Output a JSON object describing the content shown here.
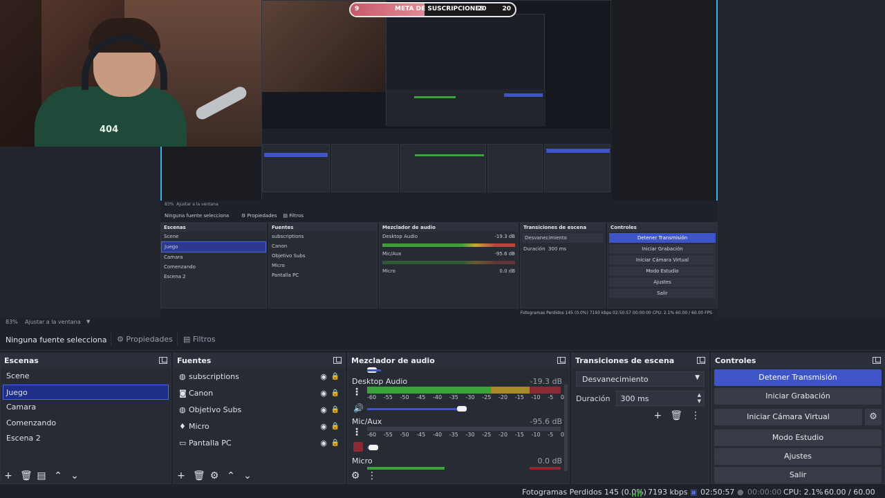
{
  "overlay": {
    "goal_label": "META DE SUSCRIPCIONES",
    "goal_current": "9",
    "goal_mid": "20",
    "goal_target": "20"
  },
  "webcam": {
    "shirt_text": "404"
  },
  "mirror": {
    "zoom": "83%",
    "fit_label": "Ajustar a la ventana",
    "no_source": "Ninguna fuente selecciona",
    "props_tab": "Propiedades",
    "filters_tab": "Filtros",
    "scenes_title": "Escenas",
    "scenes": [
      "Scene",
      "Juego",
      "Camara",
      "Comenzando",
      "Escena 2"
    ],
    "sources_title": "Fuentes",
    "sources": [
      "subscriptions",
      "Canon",
      "Objetivo Subs",
      "Micro",
      "Pantalla PC"
    ],
    "mixer_title": "Mezclador de audio",
    "ch1": "Desktop Audio",
    "ch1_db": "-19.3 dB",
    "ch2": "Mic/Aux",
    "ch2_db": "-95.6 dB",
    "ch3": "Micro",
    "ch3_db": "0.0 dB",
    "trans_title": "Transiciones de escena",
    "trans_value": "Desvanecimiento",
    "duration_label": "Duración",
    "duration_value": "300 ms",
    "controls_title": "Controles",
    "controls": [
      "Detener Transmisión",
      "Iniciar Grabación",
      "Iniciar Cámara Virtual",
      "Modo Estudio",
      "Ajustes",
      "Salir"
    ],
    "status": "Fotogramas Perdidos 145 (0.0%)   7193 kbps   02:50:57   00:00:00   CPU: 2.1%   60.00 / 60.00 FPS"
  },
  "zoom_bar": {
    "zoom": "83%",
    "fit_label": "Ajustar a la ventana"
  },
  "props_bar": {
    "no_source": "Ninguna fuente selecciona",
    "props_tab": "Propiedades",
    "filters_tab": "Filtros"
  },
  "scenes": {
    "title": "Escenas",
    "items": [
      "Scene",
      "Juego",
      "Camara",
      "Comenzando",
      "Escena 2"
    ],
    "selected_index": 1
  },
  "sources": {
    "title": "Fuentes",
    "items": [
      {
        "label": "subscriptions",
        "icon": "globe-icon"
      },
      {
        "label": "Canon",
        "icon": "camera-icon"
      },
      {
        "label": "Objetivo Subs",
        "icon": "globe-icon"
      },
      {
        "label": "Micro",
        "icon": "microphone-icon"
      },
      {
        "label": "Pantalla PC",
        "icon": "monitor-icon"
      }
    ]
  },
  "mixer": {
    "title": "Mezclador de audio",
    "ticks": [
      "-60",
      "-55",
      "-50",
      "-45",
      "-40",
      "-35",
      "-30",
      "-25",
      "-20",
      "-15",
      "-10",
      "-5",
      "0"
    ],
    "channels": [
      {
        "name": "Desktop Audio",
        "db": "-19.3 dB"
      },
      {
        "name": "Mic/Aux",
        "db": "-95.6 dB"
      },
      {
        "name": "Micro",
        "db": "0.0 dB"
      }
    ]
  },
  "transitions": {
    "title": "Transiciones de escena",
    "selected": "Desvanecimiento",
    "duration_label": "Duración",
    "duration_value": "300 ms"
  },
  "controls": {
    "title": "Controles",
    "stop_stream": "Detener Transmisión",
    "start_recording": "Iniciar Grabación",
    "start_virtual_cam": "Iniciar Cámara Virtual",
    "studio_mode": "Modo Estudio",
    "settings": "Ajustes",
    "exit": "Salir"
  },
  "status": {
    "dropped_frames": "Fotogramas Perdidos 145 (0.0%)",
    "bitrate": "7193 kbps",
    "stream_time": "02:50:57",
    "rec_time": "00:00:00",
    "cpu": "CPU: 2.1%",
    "fps": "60.00 / 60.00 FPS"
  },
  "colors": {
    "accent": "#3d55c7",
    "panel": "#272b34",
    "background": "#1e2129",
    "meter_green": "#3aa33a",
    "meter_yellow": "#a78a2a",
    "meter_red": "#8a2b33"
  }
}
